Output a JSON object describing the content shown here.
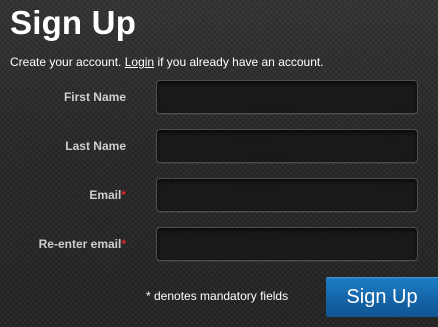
{
  "page": {
    "title": "Sign Up",
    "subtitle_before": "Create your account. ",
    "login_link": "Login",
    "subtitle_after": " if you already have an account."
  },
  "form": {
    "fields": [
      {
        "label": "First Name",
        "required": false,
        "value": ""
      },
      {
        "label": "Last Name",
        "required": false,
        "value": ""
      },
      {
        "label": "Email",
        "required": true,
        "value": ""
      },
      {
        "label": "Re-enter email",
        "required": true,
        "value": ""
      }
    ],
    "required_marker": "*",
    "mandatory_note": "* denotes mandatory fields",
    "submit_label": "Sign Up"
  },
  "colors": {
    "background": "#2b2b2b",
    "input_background": "#171717",
    "label_text": "#cfcfcf",
    "required_marker": "#e0262b",
    "button": "#1565a8"
  }
}
